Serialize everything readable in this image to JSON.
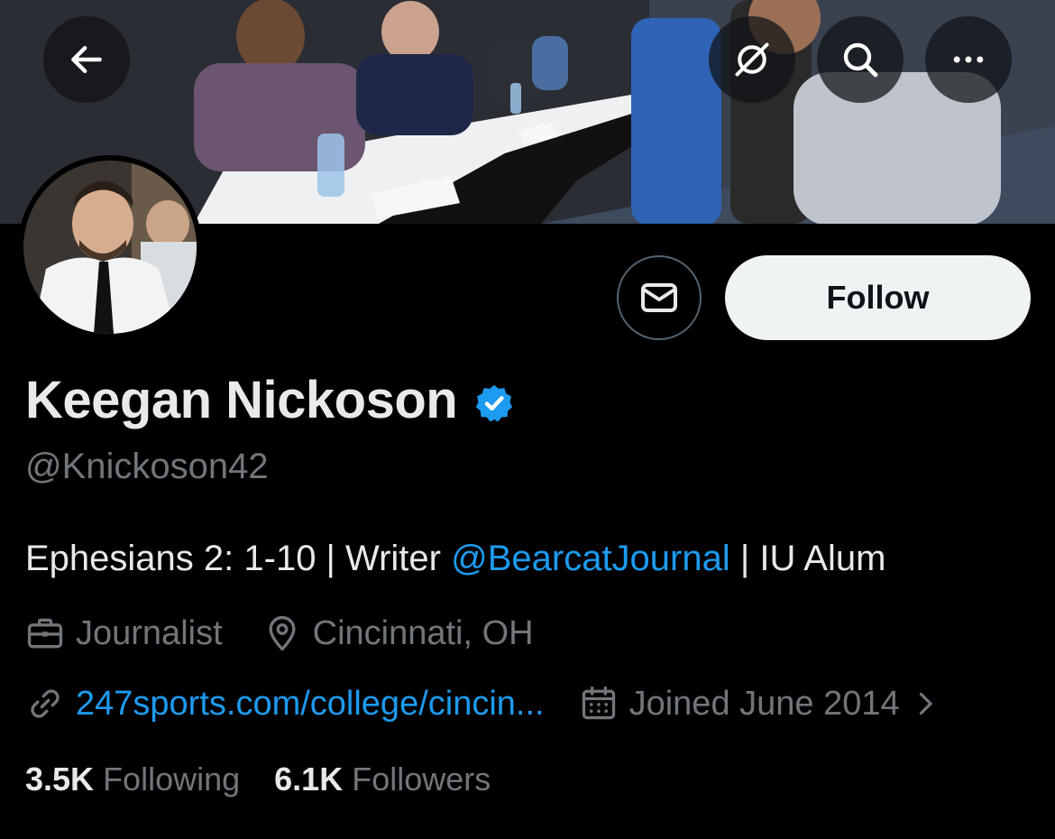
{
  "colors": {
    "background": "#000000",
    "text_primary": "#e7e9ea",
    "text_secondary": "#71767b",
    "accent": "#1d9bf0",
    "follow_bg": "#eff3f4"
  },
  "header": {
    "back_icon": "arrow-left-icon",
    "actions": [
      "grok-icon",
      "search-icon",
      "more-icon"
    ]
  },
  "profile": {
    "name": "Keegan Nickoson",
    "verified": true,
    "handle": "@Knickoson42",
    "follow_label": "Follow",
    "message_icon": "envelope-icon",
    "bio": {
      "prefix": "Ephesians 2: 1-10 | Writer ",
      "mention": "@BearcatJournal",
      "suffix": " | IU Alum"
    },
    "category": "Journalist",
    "location": "Cincinnati, OH",
    "website": "247sports.com/college/cincin...",
    "joined": "Joined June 2014",
    "following_count": "3.5K",
    "following_label": "Following",
    "followers_count": "6.1K",
    "followers_label": "Followers"
  }
}
